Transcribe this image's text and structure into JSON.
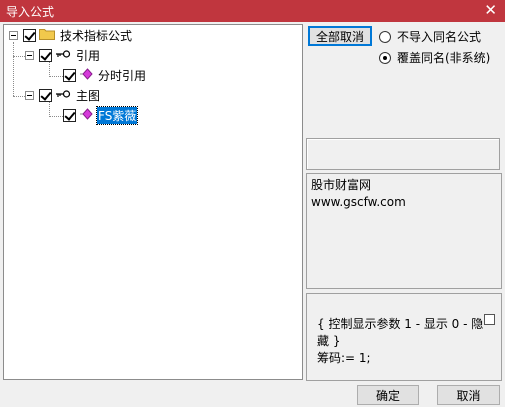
{
  "window": {
    "title": "导入公式",
    "close_glyph": "✕"
  },
  "tree": {
    "root": {
      "label": "技术指标公式",
      "checked": true,
      "icon": "folder-icon"
    },
    "group_ref": {
      "label": "引用",
      "checked": true,
      "icon": "key-icon"
    },
    "item_ref": {
      "label": "分时引用",
      "checked": true,
      "icon": "formula-icon"
    },
    "group_main": {
      "label": "主图",
      "checked": true,
      "icon": "key-icon"
    },
    "item_main": {
      "label": "FS紫薇",
      "checked": true,
      "selected": true,
      "icon": "formula-icon"
    }
  },
  "options": {
    "select_all_cancel": "全部取消",
    "radio_no_import": "不导入同名公式",
    "radio_overwrite": "覆盖同名(非系统)",
    "selected_radio": "radio_overwrite"
  },
  "info": {
    "line1": "股市财富网",
    "line2": "www.gscfw.com"
  },
  "code": {
    "line1": "{ 控制显示参数 1 - 显示 0 - 隐",
    "line2": "藏 }",
    "line3": "筹码:= 1;"
  },
  "footer": {
    "ok": "确定",
    "cancel": "取消"
  },
  "colors": {
    "titlebar": "#c0363e",
    "selection": "#0078d7",
    "folder": "#f2c94c",
    "formula": "#d63adb"
  }
}
